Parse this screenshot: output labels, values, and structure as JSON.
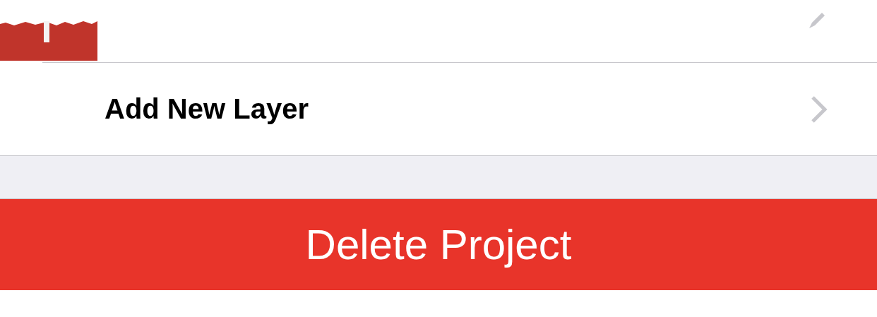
{
  "add_row": {
    "label": "Add New Layer"
  },
  "delete_button": {
    "label": "Delete Project"
  }
}
